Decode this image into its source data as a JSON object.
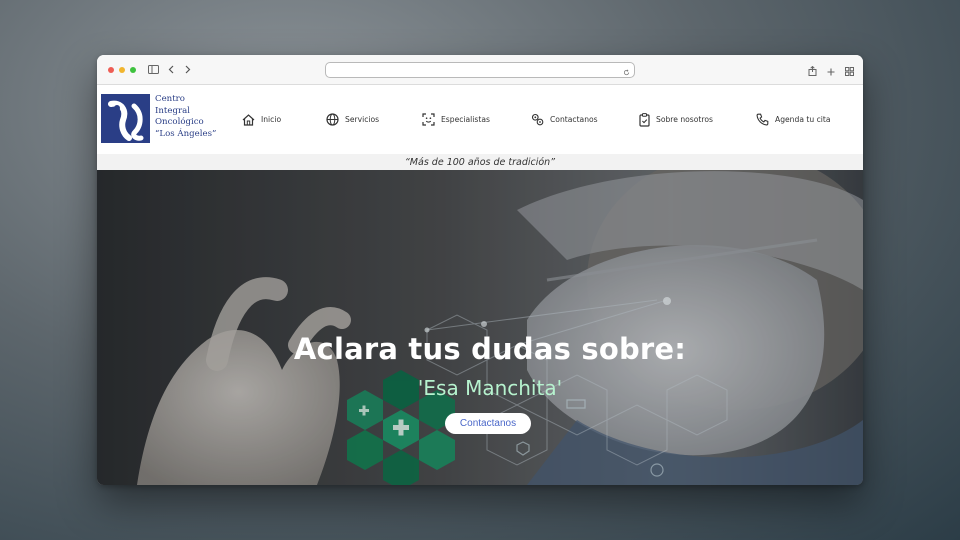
{
  "site": {
    "logo_lines": [
      "Centro",
      "Integral",
      "Oncológico",
      "“Los Ángeles”"
    ],
    "tagline": "“Más de 100 años de tradición”"
  },
  "nav": [
    {
      "label": "Inicio",
      "icon": "home-icon"
    },
    {
      "label": "Servicios",
      "icon": "globe-icon"
    },
    {
      "label": "Especialistas",
      "icon": "face-scan-icon"
    },
    {
      "label": "Contactanos",
      "icon": "location-pins-icon"
    },
    {
      "label": "Sobre nosotros",
      "icon": "clipboard-icon"
    },
    {
      "label": "Agenda tu cita",
      "icon": "phone-icon"
    }
  ],
  "hero": {
    "title": "Aclara tus dudas sobre:",
    "subtitle": "'Esa Manchita'",
    "button_label": "Contactanos"
  },
  "colors": {
    "brand_blue": "#2a3e86",
    "subtitle_green": "#b6f2ce",
    "button_text": "#4a67c9"
  }
}
